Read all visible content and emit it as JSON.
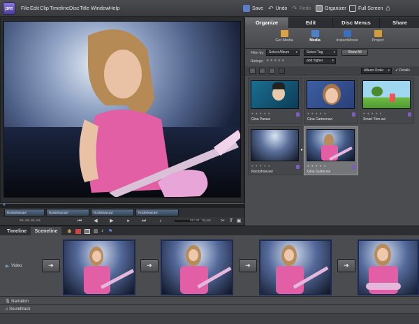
{
  "app": {
    "logo_text": "pre"
  },
  "menu": [
    "File",
    "Edit",
    "Clip",
    "Timeline",
    "Disc",
    "Title",
    "Window",
    "Help"
  ],
  "toolbar": {
    "save": "Save",
    "undo": "Undo",
    "redo": "Redo",
    "organizer": "Organizer",
    "full_screen": "Full Screen"
  },
  "monitor": {
    "clips": [
      "Rockshow.avi",
      "Rockshow.avi",
      "Rockshow.avi",
      "Rockshow.avi"
    ],
    "timecode_left": "00;00;00;00",
    "timecode_right": "00;00;16;00"
  },
  "tabs": {
    "main": [
      "Organize",
      "Edit",
      "Disc Menus",
      "Share"
    ],
    "active_main": "Organize",
    "sub": [
      "Get Media",
      "Media",
      "InstantMovie",
      "Project"
    ],
    "active_sub": "Media"
  },
  "filters": {
    "filter_by_label": "Filter by:",
    "album": "Select Album",
    "tag": "Select Tag",
    "show_all": "Show All",
    "ratings_label": "Ratings:",
    "ratings_value": "and higher",
    "sort": "Album Order",
    "details": "Details"
  },
  "media": [
    {
      "name": "Gina Panavi"
    },
    {
      "name": "Gina Cartoonavi"
    },
    {
      "name": "Smart Trim.avi"
    },
    {
      "name": "Rockshow.avi"
    },
    {
      "name": "Gina Guitar.avi"
    }
  ],
  "timeline": {
    "tabs": [
      "Timeline",
      "Sceneline"
    ],
    "active": "Sceneline",
    "tracks": {
      "video": "Video",
      "narration": "Narration",
      "soundtrack": "Soundtrack"
    }
  },
  "colors": {
    "accent": "#3a5ba8",
    "brand": "#6a55c0"
  }
}
